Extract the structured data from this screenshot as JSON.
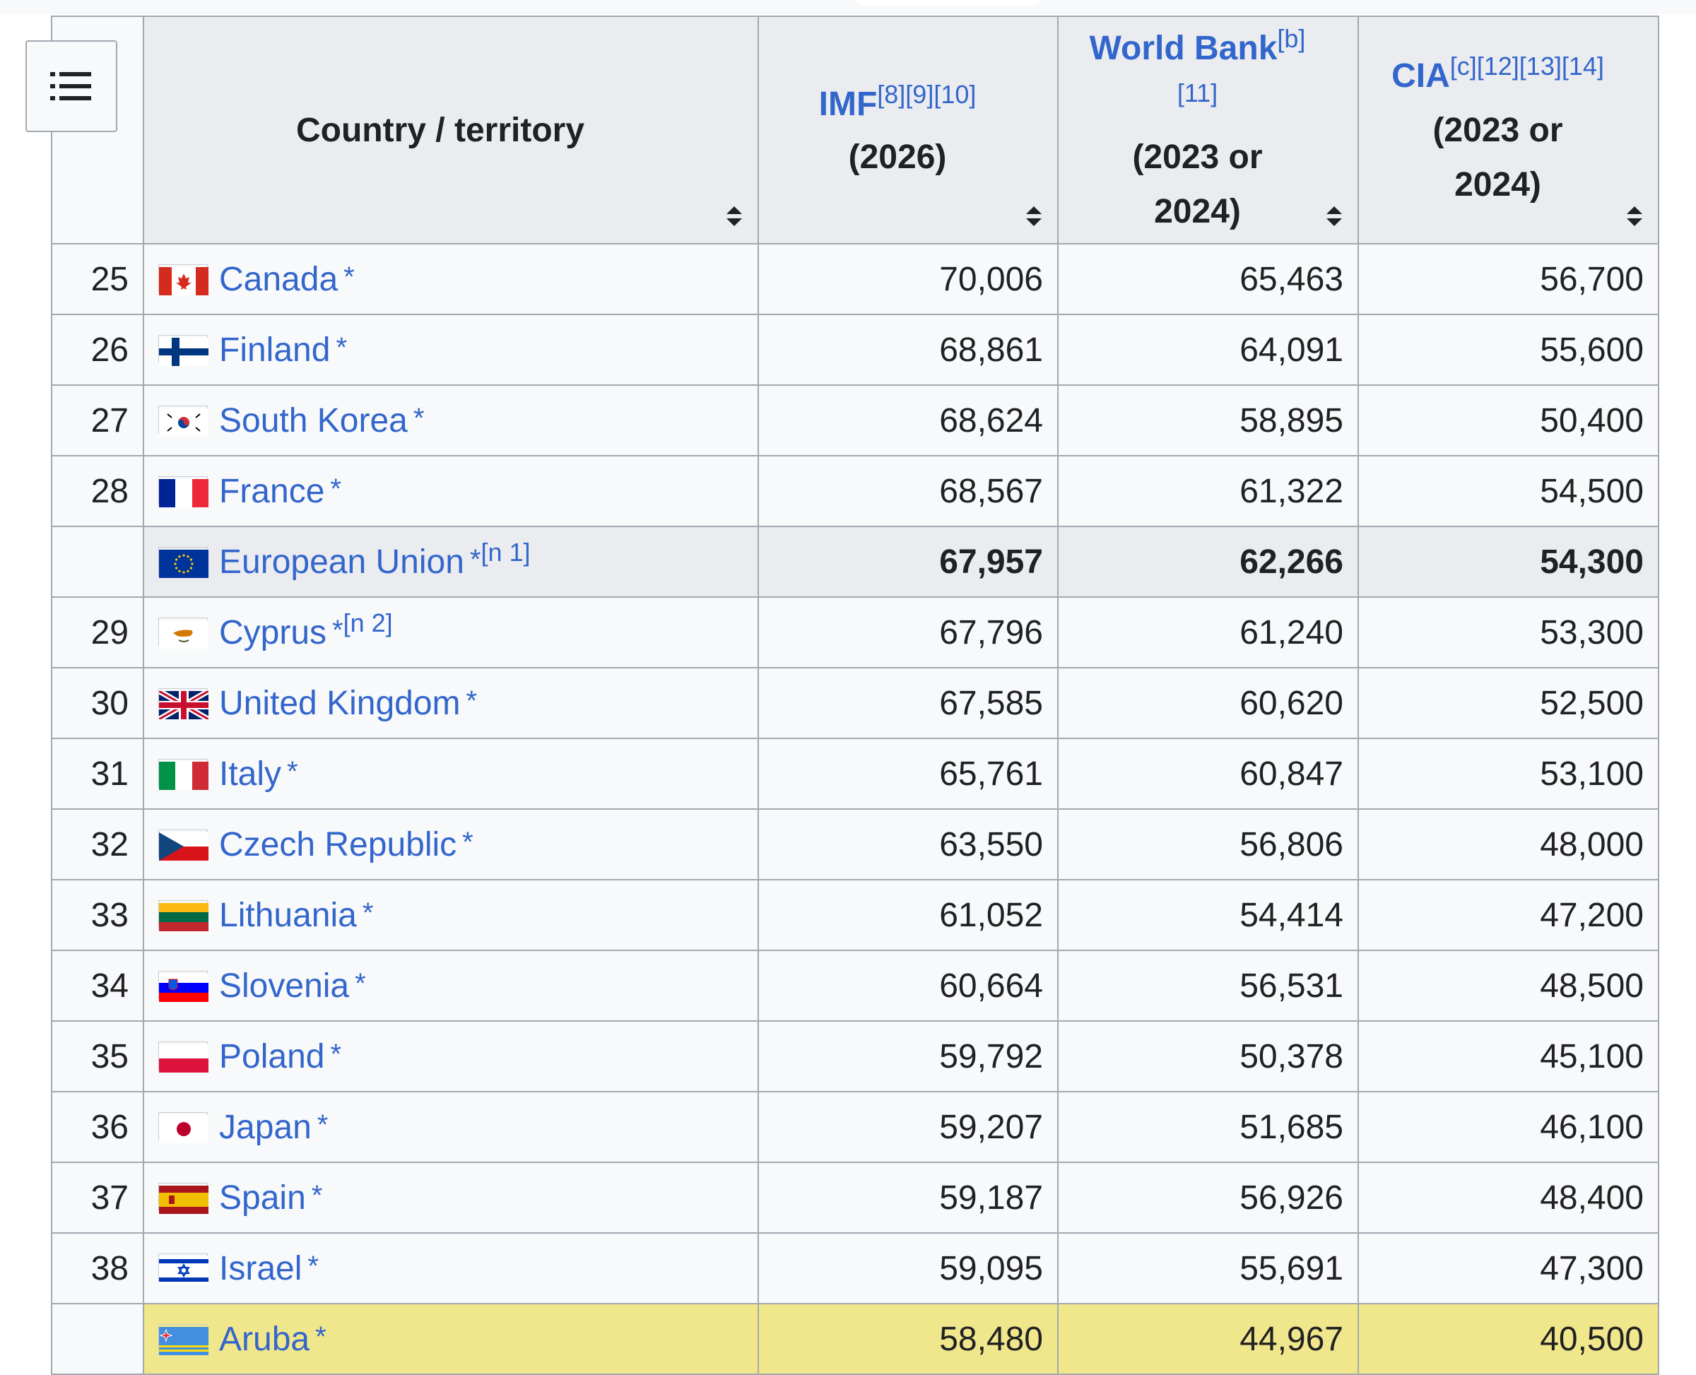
{
  "table": {
    "headers": {
      "country": "Country / territory",
      "imf": {
        "name": "IMF",
        "refs": "[8][9][10]",
        "year": "(2026)"
      },
      "world_bank": {
        "name": "World Bank",
        "refs": "[b][11]",
        "year_line1": "(2023 or",
        "year_line2": "2024)"
      },
      "cia": {
        "name": "CIA",
        "refs": "[c][12][13][14]",
        "year_line1": "(2023 or",
        "year_line2": "2024)"
      }
    },
    "rows": [
      {
        "rank": "25",
        "country": "Canada",
        "star": "*",
        "note": "",
        "flag": "canada-flag-icon",
        "imf": "70,006",
        "wb": "65,463",
        "cia": "56,700"
      },
      {
        "rank": "26",
        "country": "Finland",
        "star": "*",
        "note": "",
        "flag": "finland-flag-icon",
        "imf": "68,861",
        "wb": "64,091",
        "cia": "55,600"
      },
      {
        "rank": "27",
        "country": "South Korea",
        "star": "*",
        "note": "",
        "flag": "south-korea-flag-icon",
        "imf": "68,624",
        "wb": "58,895",
        "cia": "50,400"
      },
      {
        "rank": "28",
        "country": "France",
        "star": "*",
        "note": "",
        "flag": "france-flag-icon",
        "imf": "68,567",
        "wb": "61,322",
        "cia": "54,500"
      },
      {
        "rank": "",
        "country": "European Union",
        "star": "*",
        "note": "[n 1]",
        "flag": "eu-flag-icon",
        "imf": "67,957",
        "wb": "62,266",
        "cia": "54,300"
      },
      {
        "rank": "29",
        "country": "Cyprus",
        "star": "*",
        "note": "[n 2]",
        "flag": "cyprus-flag-icon",
        "imf": "67,796",
        "wb": "61,240",
        "cia": "53,300"
      },
      {
        "rank": "30",
        "country": "United Kingdom",
        "star": "*",
        "note": "",
        "flag": "uk-flag-icon",
        "imf": "67,585",
        "wb": "60,620",
        "cia": "52,500"
      },
      {
        "rank": "31",
        "country": "Italy",
        "star": "*",
        "note": "",
        "flag": "italy-flag-icon",
        "imf": "65,761",
        "wb": "60,847",
        "cia": "53,100"
      },
      {
        "rank": "32",
        "country": "Czech Republic",
        "star": "*",
        "note": "",
        "flag": "czech-flag-icon",
        "imf": "63,550",
        "wb": "56,806",
        "cia": "48,000"
      },
      {
        "rank": "33",
        "country": "Lithuania",
        "star": "*",
        "note": "",
        "flag": "lithuania-flag-icon",
        "imf": "61,052",
        "wb": "54,414",
        "cia": "47,200"
      },
      {
        "rank": "34",
        "country": "Slovenia",
        "star": "*",
        "note": "",
        "flag": "slovenia-flag-icon",
        "imf": "60,664",
        "wb": "56,531",
        "cia": "48,500"
      },
      {
        "rank": "35",
        "country": "Poland",
        "star": "*",
        "note": "",
        "flag": "poland-flag-icon",
        "imf": "59,792",
        "wb": "50,378",
        "cia": "45,100"
      },
      {
        "rank": "36",
        "country": "Japan",
        "star": "*",
        "note": "",
        "flag": "japan-flag-icon",
        "imf": "59,207",
        "wb": "51,685",
        "cia": "46,100"
      },
      {
        "rank": "37",
        "country": "Spain",
        "star": "*",
        "note": "",
        "flag": "spain-flag-icon",
        "imf": "59,187",
        "wb": "56,926",
        "cia": "48,400"
      },
      {
        "rank": "38",
        "country": "Israel",
        "star": "*",
        "note": "",
        "flag": "israel-flag-icon",
        "imf": "59,095",
        "wb": "55,691",
        "cia": "47,300"
      },
      {
        "rank": "",
        "country": "Aruba",
        "star": "*",
        "note": "",
        "flag": "aruba-flag-icon",
        "imf": "58,480",
        "wb": "44,967",
        "cia": "40,500"
      }
    ]
  },
  "colors": {
    "link": "#3366cc",
    "header_bg": "#eaecf0",
    "cell_bg": "#f8f9fa",
    "border": "#a2a9b1",
    "highlight_eu": "#eaecf0",
    "highlight_territory": "#f0e68c"
  },
  "toc_button": {
    "icon": "list-icon"
  }
}
